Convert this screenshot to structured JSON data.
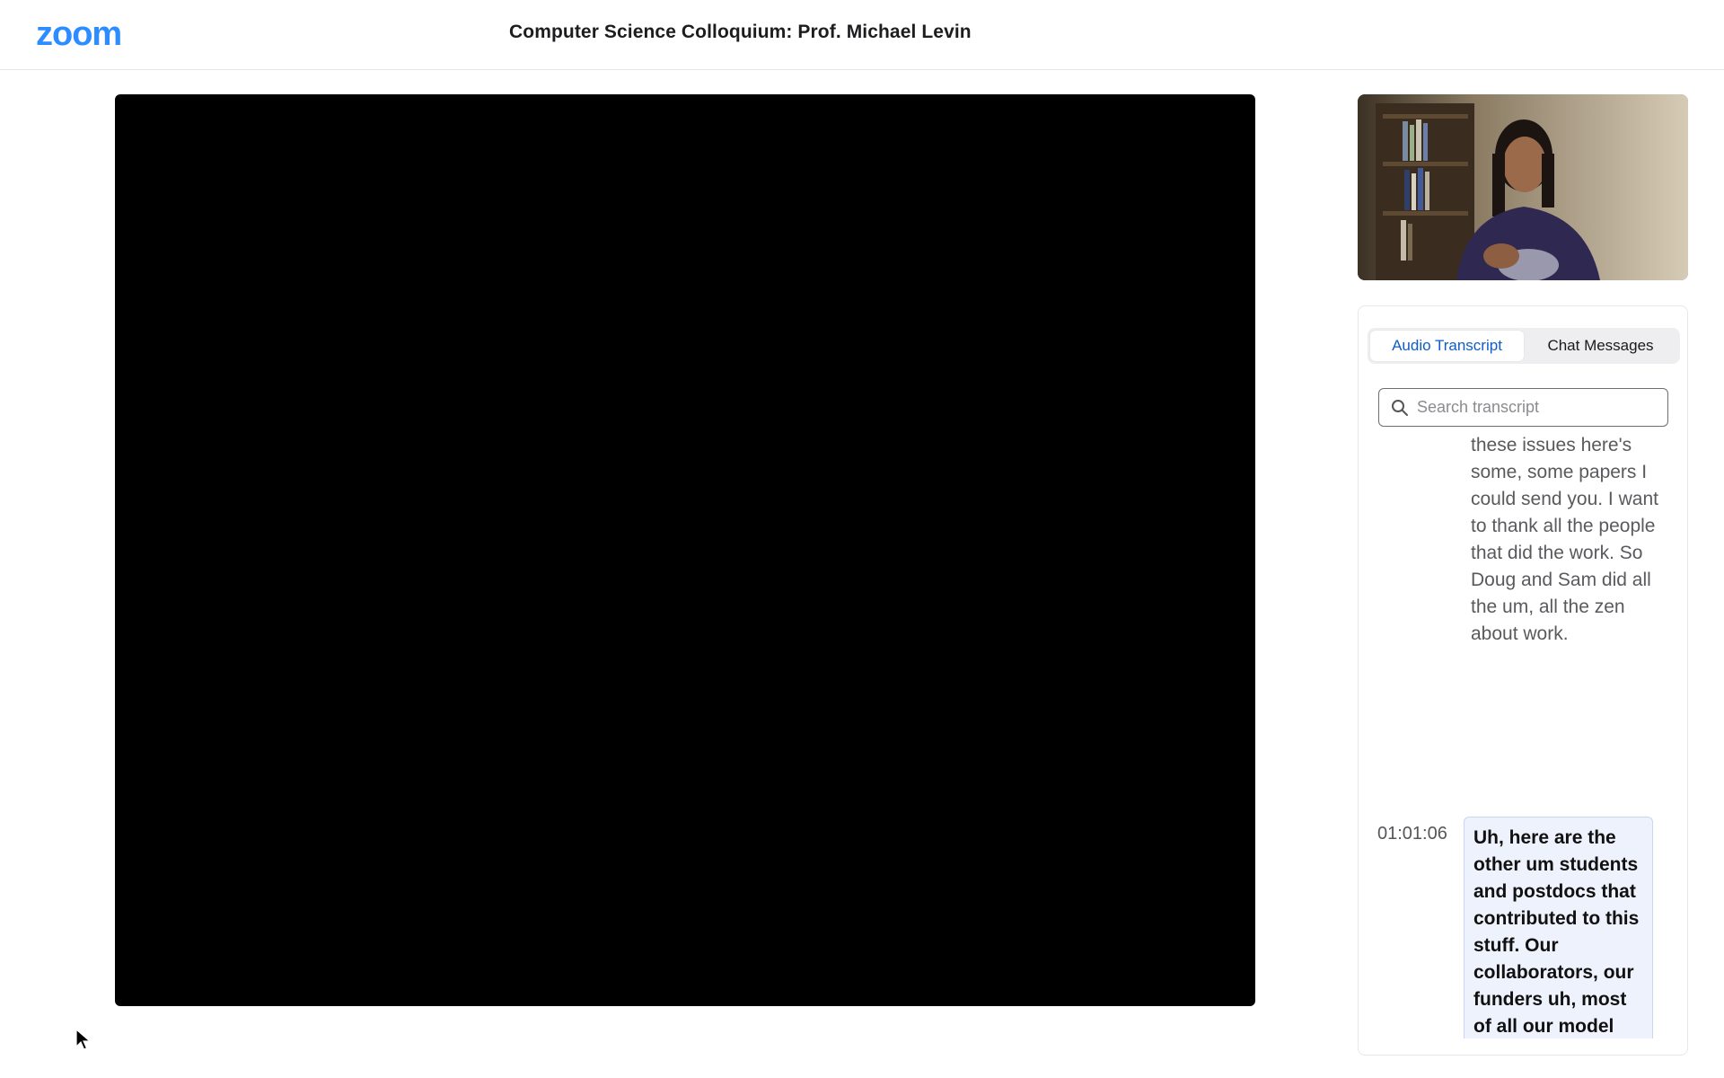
{
  "app": {
    "logo_text": "zoom",
    "brand_color": "#2d8cff"
  },
  "header": {
    "meeting_title": "Computer Science Colloquium: Prof. Michael Levin"
  },
  "main_video": {
    "state": "black"
  },
  "panel": {
    "tabs": [
      {
        "label": "Audio Transcript",
        "active": true
      },
      {
        "label": "Chat Messages",
        "active": false
      }
    ],
    "search": {
      "placeholder": "Search transcript",
      "value": ""
    },
    "transcript": {
      "previous_entry_text": "these issues here's some, some papers I could send you. I want to thank all the people that did the work. So Doug and Sam did all the um, all the zen about work.",
      "current_entry": {
        "time": "01:01:06",
        "text": "Uh, here are the other um students and postdocs that contributed to this stuff. Our collaborators, our funders uh, most of all our model systems. The animals do most of the of the heavy lifting here. Um, and"
      }
    }
  },
  "icons": {
    "search": "search-icon",
    "cursor": "mouse-pointer-icon"
  }
}
